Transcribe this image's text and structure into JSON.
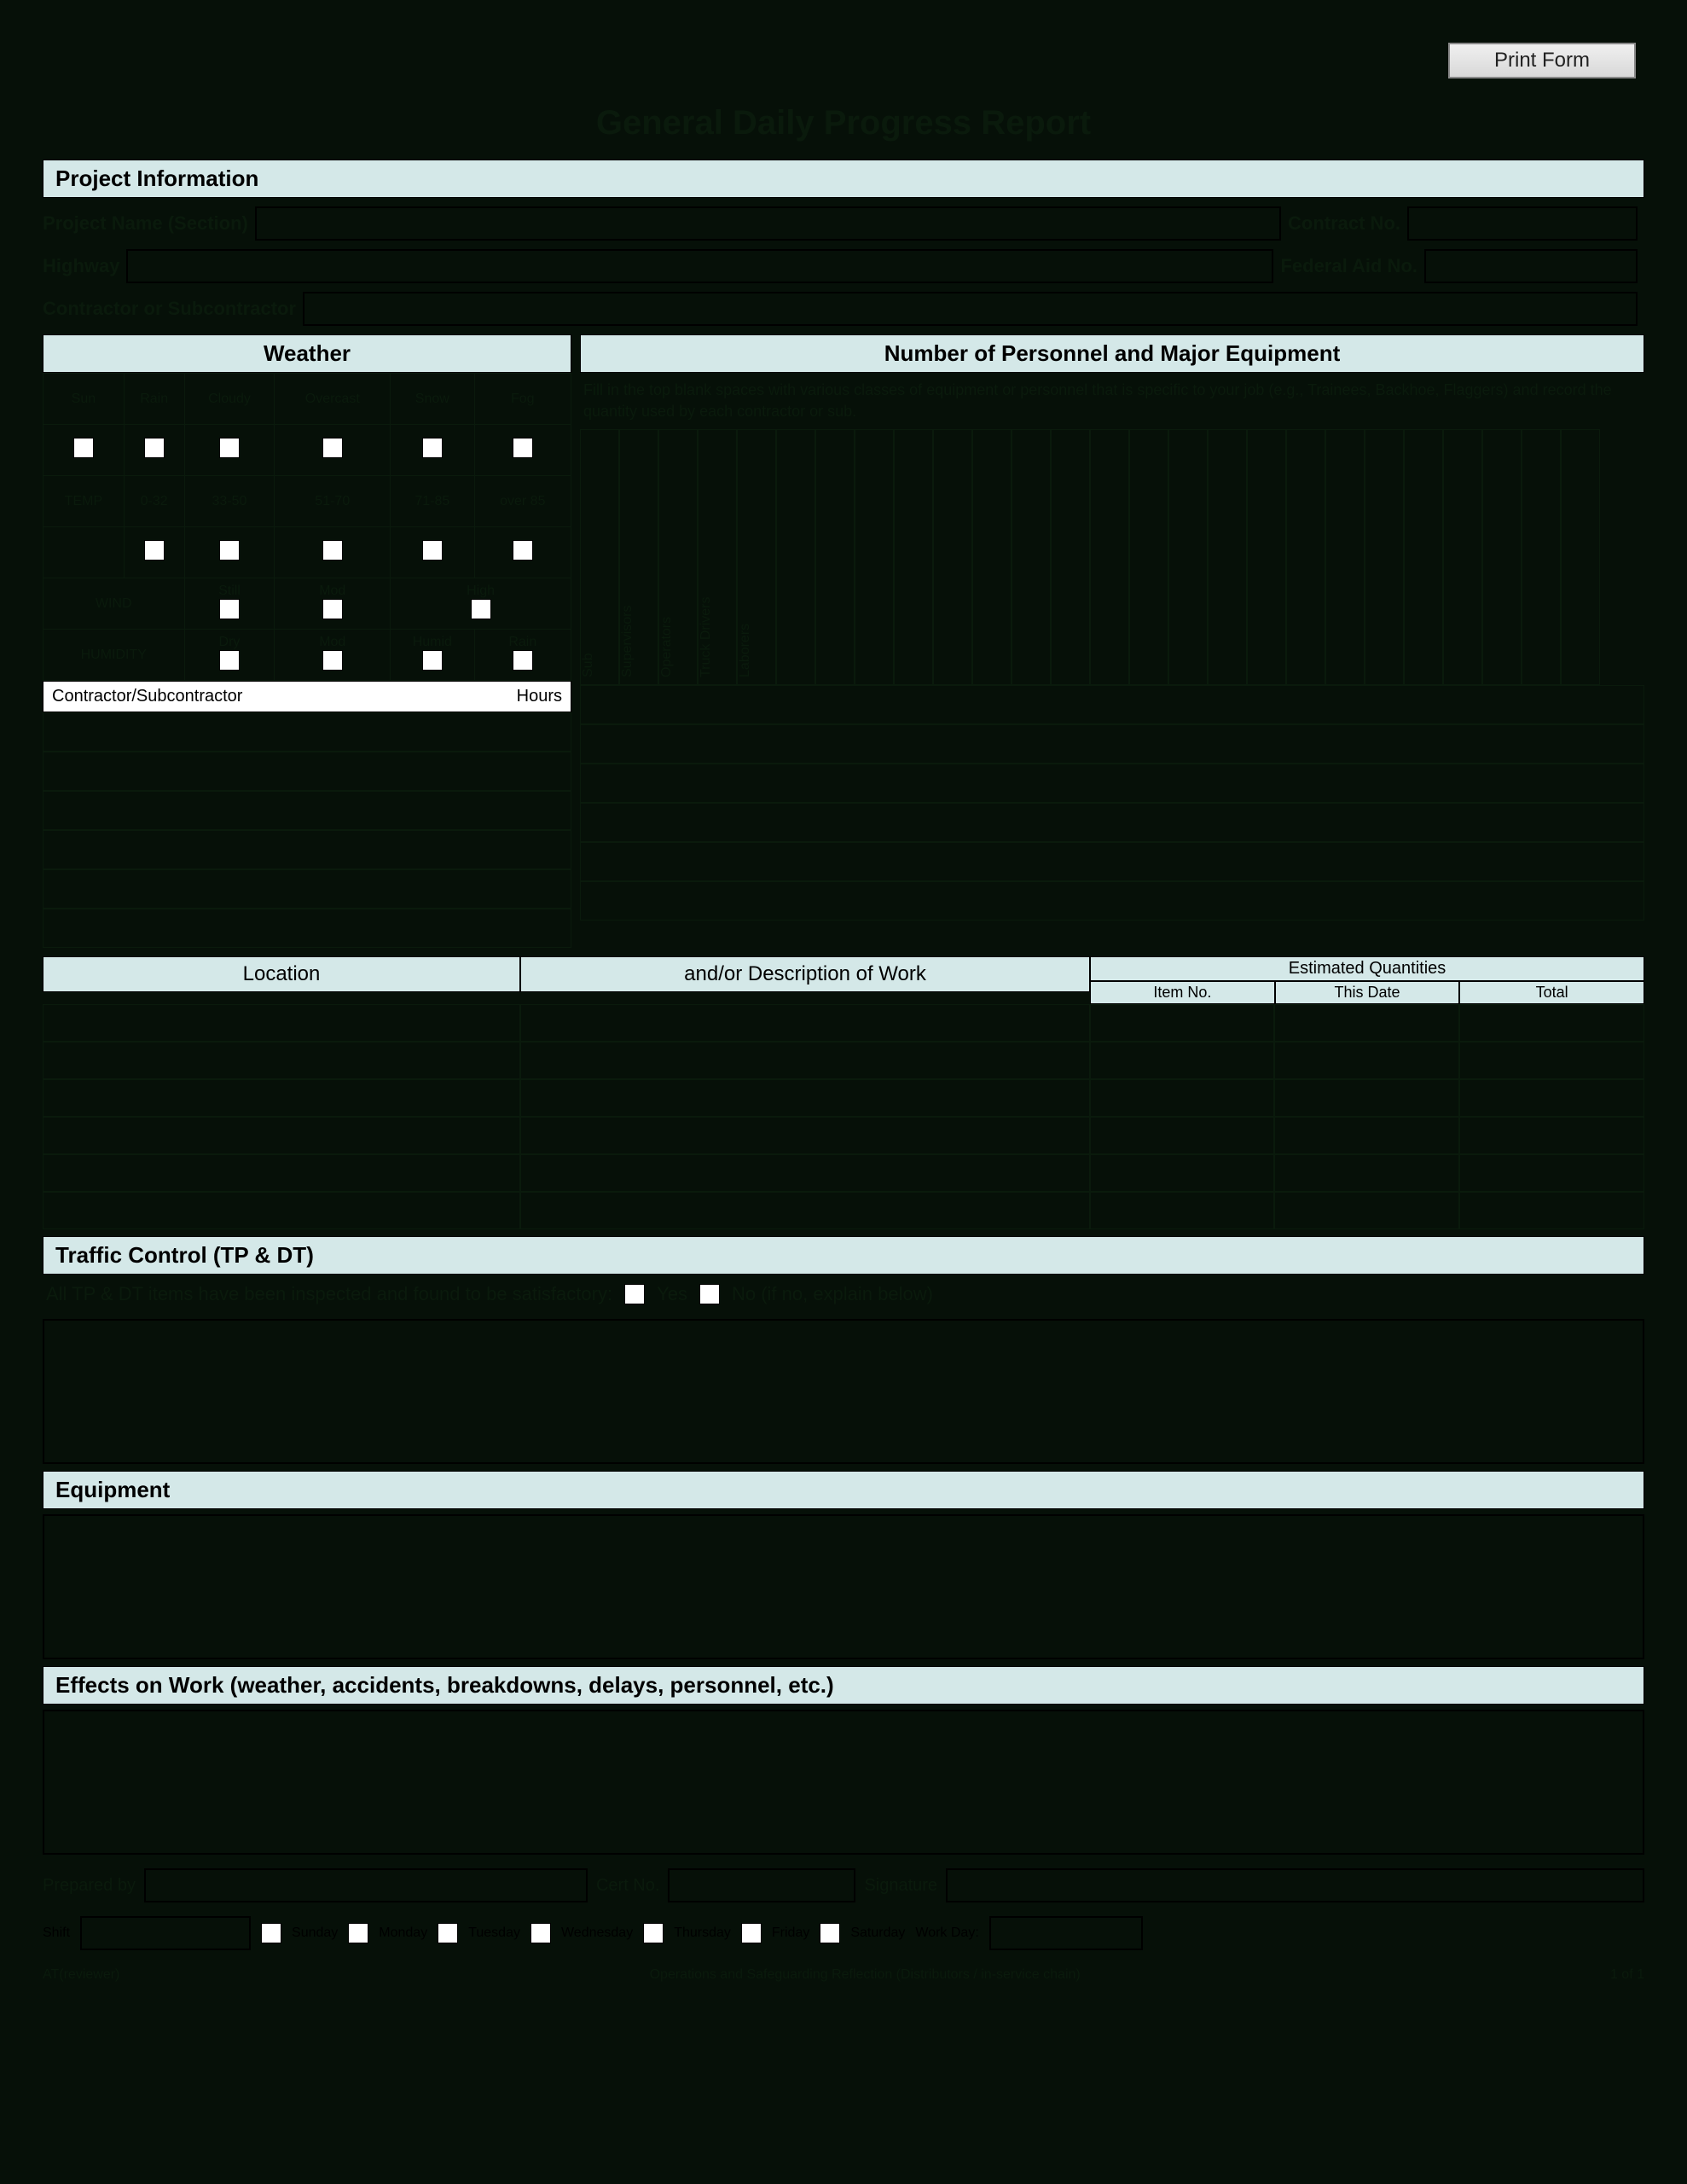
{
  "print_button": "Print Form",
  "title": "General Daily Progress Report",
  "sections": {
    "project_info": "Project Information",
    "weather": "Weather",
    "personnel": "Number of Personnel and Major Equipment",
    "location": "Location",
    "description": "and/or Description of Work",
    "est_qty": "Estimated Quantities",
    "est_cols": {
      "item": "Item No.",
      "date": "This Date",
      "total": "Total"
    },
    "traffic": "Traffic Control (TP & DT)",
    "equipment": "Equipment",
    "effects": "Effects on Work (weather, accidents, breakdowns, delays, personnel, etc.)"
  },
  "project_labels": {
    "name": "Project Name (Section)",
    "contract": "Contract No.",
    "highway": "Highway",
    "federal": "Federal Aid No.",
    "contractor": "Contractor or Subcontractor"
  },
  "weather_table": {
    "sky_row": [
      "Sun",
      "Rain",
      "Cloudy",
      "Overcast",
      "Snow",
      "Fog"
    ],
    "temp_row_label": "TEMP",
    "temp_cols": [
      "0-32",
      "33-50",
      "51-70",
      "71-85",
      "over 85"
    ],
    "wind_row_label": "WIND",
    "wind_cols": [
      "Still",
      "Mod",
      "High"
    ],
    "humidity_row_label": "HUMIDITY",
    "humidity_cols": [
      "Dry",
      "Mod",
      "Humid",
      "Rain"
    ],
    "contractor_label": "Contractor/Subcontractor",
    "hours_label": "Hours"
  },
  "personnel_hint": "Fill in the top blank spaces with various classes of equipment or personnel that is specific to your job (e.g., Trainees, Backhoe, Flaggers) and record the quantity used by each contractor or sub.",
  "personnel_cols": [
    "Sub",
    "Supervisors",
    "Operators",
    "Truck Drivers",
    "Laborers"
  ],
  "traffic_line": {
    "prompt": "All TP & DT items have been inspected and found to be satisfactory:",
    "yes": "Yes",
    "no": "No (if no, explain below)"
  },
  "bottom": {
    "prepared": "Prepared by",
    "cert": "Cert No.",
    "signature": "Signature",
    "shift": "Shift",
    "days": [
      "Sunday",
      "Monday",
      "Tuesday",
      "Wednesday",
      "Thursday",
      "Friday",
      "Saturday"
    ],
    "work_day": "Work Day:"
  },
  "footer": {
    "left": "AT(reviewer)",
    "center": "Operations and Safeguarding Reflection (Distributors / in-service chain)",
    "right": "1 of 1"
  }
}
